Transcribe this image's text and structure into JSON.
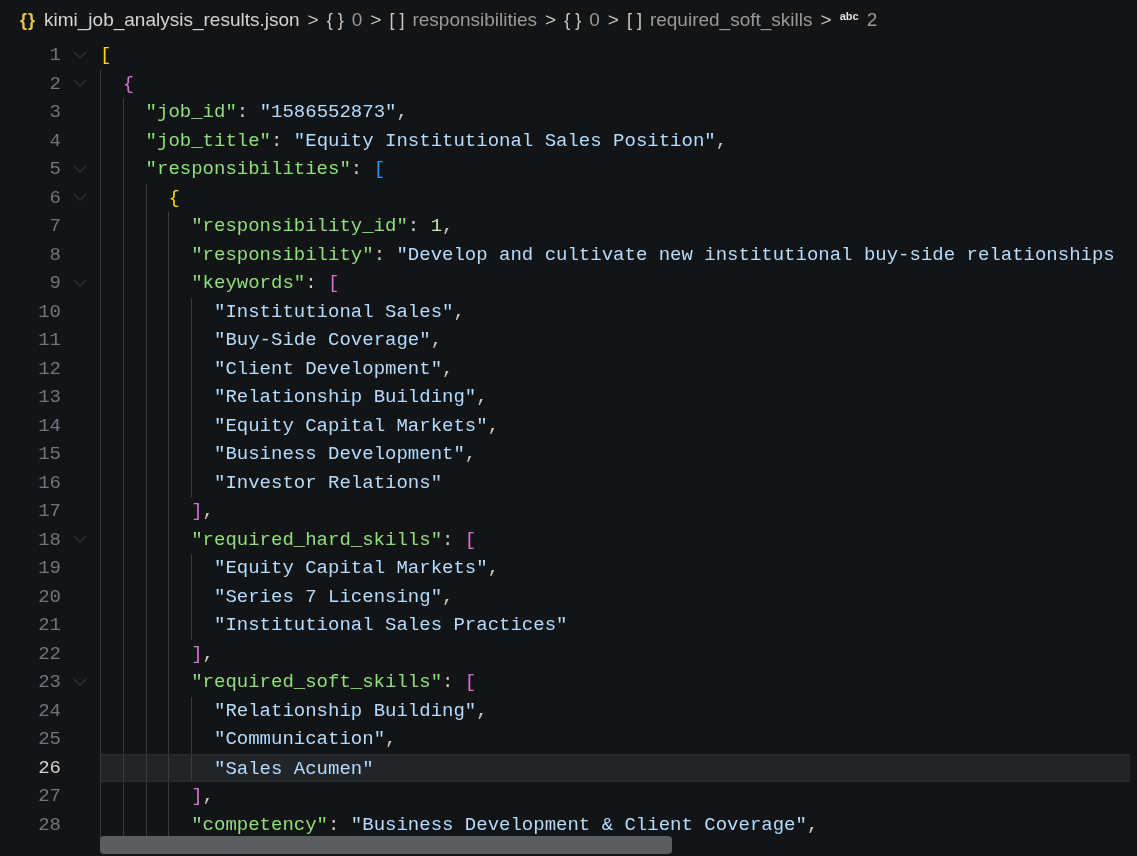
{
  "breadcrumb": [
    {
      "kind": "file",
      "icon": "{}",
      "label": "kimi_job_analysis_results.json",
      "separator": ">"
    },
    {
      "kind": "object",
      "icon": "{ }",
      "label": "0",
      "separator": ">"
    },
    {
      "kind": "array",
      "icon": "[ ]",
      "label": "responsibilities",
      "separator": ">"
    },
    {
      "kind": "object",
      "icon": "{ }",
      "label": "0",
      "separator": ">"
    },
    {
      "kind": "array",
      "icon": "[ ]",
      "label": "required_soft_skills",
      "separator": ">"
    },
    {
      "kind": "string",
      "icon": "abc",
      "label": "2"
    }
  ],
  "editor": {
    "lines": [
      {
        "number": "1",
        "foldable": true,
        "current": false,
        "tokens": [
          {
            "kind": "open",
            "text": "[",
            "color": "#ffd700"
          }
        ]
      },
      {
        "number": "2",
        "foldable": true,
        "current": false,
        "tokens": [
          {
            "kind": "open",
            "text": "{",
            "color": "#da70d6"
          }
        ]
      },
      {
        "number": "3",
        "foldable": false,
        "current": false,
        "tokens": [
          {
            "kind": "key",
            "text": "\"job_id\""
          },
          {
            "kind": "punct",
            "text": ": "
          },
          {
            "kind": "string",
            "text": "\"1586552873\""
          },
          {
            "kind": "punct",
            "text": ","
          }
        ]
      },
      {
        "number": "4",
        "foldable": false,
        "current": false,
        "tokens": [
          {
            "kind": "key",
            "text": "\"job_title\""
          },
          {
            "kind": "punct",
            "text": ": "
          },
          {
            "kind": "string",
            "text": "\"Equity Institutional Sales Position\""
          },
          {
            "kind": "punct",
            "text": ","
          }
        ]
      },
      {
        "number": "5",
        "foldable": true,
        "current": false,
        "tokens": [
          {
            "kind": "key",
            "text": "\"responsibilities\""
          },
          {
            "kind": "punct",
            "text": ": "
          },
          {
            "kind": "open",
            "text": "[",
            "color": "#179fff"
          }
        ]
      },
      {
        "number": "6",
        "foldable": true,
        "current": false,
        "tokens": [
          {
            "kind": "open",
            "text": "{",
            "color": "#ffd700"
          }
        ]
      },
      {
        "number": "7",
        "foldable": false,
        "current": false,
        "tokens": [
          {
            "kind": "key",
            "text": "\"responsibility_id\""
          },
          {
            "kind": "punct",
            "text": ": "
          },
          {
            "kind": "number",
            "text": "1"
          },
          {
            "kind": "punct",
            "text": ","
          }
        ]
      },
      {
        "number": "8",
        "foldable": false,
        "current": false,
        "tokens": [
          {
            "kind": "key",
            "text": "\"responsibility\""
          },
          {
            "kind": "punct",
            "text": ": "
          },
          {
            "kind": "string",
            "text": "\"Develop and cultivate new institutional buy-side relationships"
          }
        ]
      },
      {
        "number": "9",
        "foldable": true,
        "current": false,
        "tokens": [
          {
            "kind": "key",
            "text": "\"keywords\""
          },
          {
            "kind": "punct",
            "text": ": "
          },
          {
            "kind": "open",
            "text": "[",
            "color": "#da70d6"
          }
        ]
      },
      {
        "number": "10",
        "foldable": false,
        "current": false,
        "tokens": [
          {
            "kind": "string",
            "text": "\"Institutional Sales\""
          },
          {
            "kind": "punct",
            "text": ","
          }
        ]
      },
      {
        "number": "11",
        "foldable": false,
        "current": false,
        "tokens": [
          {
            "kind": "string",
            "text": "\"Buy-Side Coverage\""
          },
          {
            "kind": "punct",
            "text": ","
          }
        ]
      },
      {
        "number": "12",
        "foldable": false,
        "current": false,
        "tokens": [
          {
            "kind": "string",
            "text": "\"Client Development\""
          },
          {
            "kind": "punct",
            "text": ","
          }
        ]
      },
      {
        "number": "13",
        "foldable": false,
        "current": false,
        "tokens": [
          {
            "kind": "string",
            "text": "\"Relationship Building\""
          },
          {
            "kind": "punct",
            "text": ","
          }
        ]
      },
      {
        "number": "14",
        "foldable": false,
        "current": false,
        "tokens": [
          {
            "kind": "string",
            "text": "\"Equity Capital Markets\""
          },
          {
            "kind": "punct",
            "text": ","
          }
        ]
      },
      {
        "number": "15",
        "foldable": false,
        "current": false,
        "tokens": [
          {
            "kind": "string",
            "text": "\"Business Development\""
          },
          {
            "kind": "punct",
            "text": ","
          }
        ]
      },
      {
        "number": "16",
        "foldable": false,
        "current": false,
        "tokens": [
          {
            "kind": "string",
            "text": "\"Investor Relations\""
          }
        ]
      },
      {
        "number": "17",
        "foldable": false,
        "current": false,
        "tokens": [
          {
            "kind": "close",
            "text": "]",
            "color": "#da70d6"
          },
          {
            "kind": "punct",
            "text": ","
          }
        ]
      },
      {
        "number": "18",
        "foldable": true,
        "current": false,
        "tokens": [
          {
            "kind": "key",
            "text": "\"required_hard_skills\""
          },
          {
            "kind": "punct",
            "text": ": "
          },
          {
            "kind": "open",
            "text": "[",
            "color": "#da70d6"
          }
        ]
      },
      {
        "number": "19",
        "foldable": false,
        "current": false,
        "tokens": [
          {
            "kind": "string",
            "text": "\"Equity Capital Markets\""
          },
          {
            "kind": "punct",
            "text": ","
          }
        ]
      },
      {
        "number": "20",
        "foldable": false,
        "current": false,
        "tokens": [
          {
            "kind": "string",
            "text": "\"Series 7 Licensing\""
          },
          {
            "kind": "punct",
            "text": ","
          }
        ]
      },
      {
        "number": "21",
        "foldable": false,
        "current": false,
        "tokens": [
          {
            "kind": "string",
            "text": "\"Institutional Sales Practices\""
          }
        ]
      },
      {
        "number": "22",
        "foldable": false,
        "current": false,
        "tokens": [
          {
            "kind": "close",
            "text": "]",
            "color": "#da70d6"
          },
          {
            "kind": "punct",
            "text": ","
          }
        ]
      },
      {
        "number": "23",
        "foldable": true,
        "current": false,
        "tokens": [
          {
            "kind": "key",
            "text": "\"required_soft_skills\""
          },
          {
            "kind": "punct",
            "text": ": "
          },
          {
            "kind": "open",
            "text": "[",
            "color": "#da70d6"
          }
        ]
      },
      {
        "number": "24",
        "foldable": false,
        "current": false,
        "tokens": [
          {
            "kind": "string",
            "text": "\"Relationship Building\""
          },
          {
            "kind": "punct",
            "text": ","
          }
        ]
      },
      {
        "number": "25",
        "foldable": false,
        "current": false,
        "tokens": [
          {
            "kind": "string",
            "text": "\"Communication\""
          },
          {
            "kind": "punct",
            "text": ","
          }
        ]
      },
      {
        "number": "26",
        "foldable": false,
        "current": true,
        "tokens": [
          {
            "kind": "string",
            "text": "\"Sales Acumen\""
          }
        ]
      },
      {
        "number": "27",
        "foldable": false,
        "current": false,
        "tokens": [
          {
            "kind": "close",
            "text": "]",
            "color": "#da70d6"
          },
          {
            "kind": "punct",
            "text": ","
          }
        ]
      },
      {
        "number": "28",
        "foldable": false,
        "current": false,
        "tokens": [
          {
            "kind": "key",
            "text": "\"competency\""
          },
          {
            "kind": "punct",
            "text": ": "
          },
          {
            "kind": "string",
            "text": "\"Business Development & Client Coverage\""
          },
          {
            "kind": "punct",
            "text": ","
          }
        ]
      }
    ]
  }
}
